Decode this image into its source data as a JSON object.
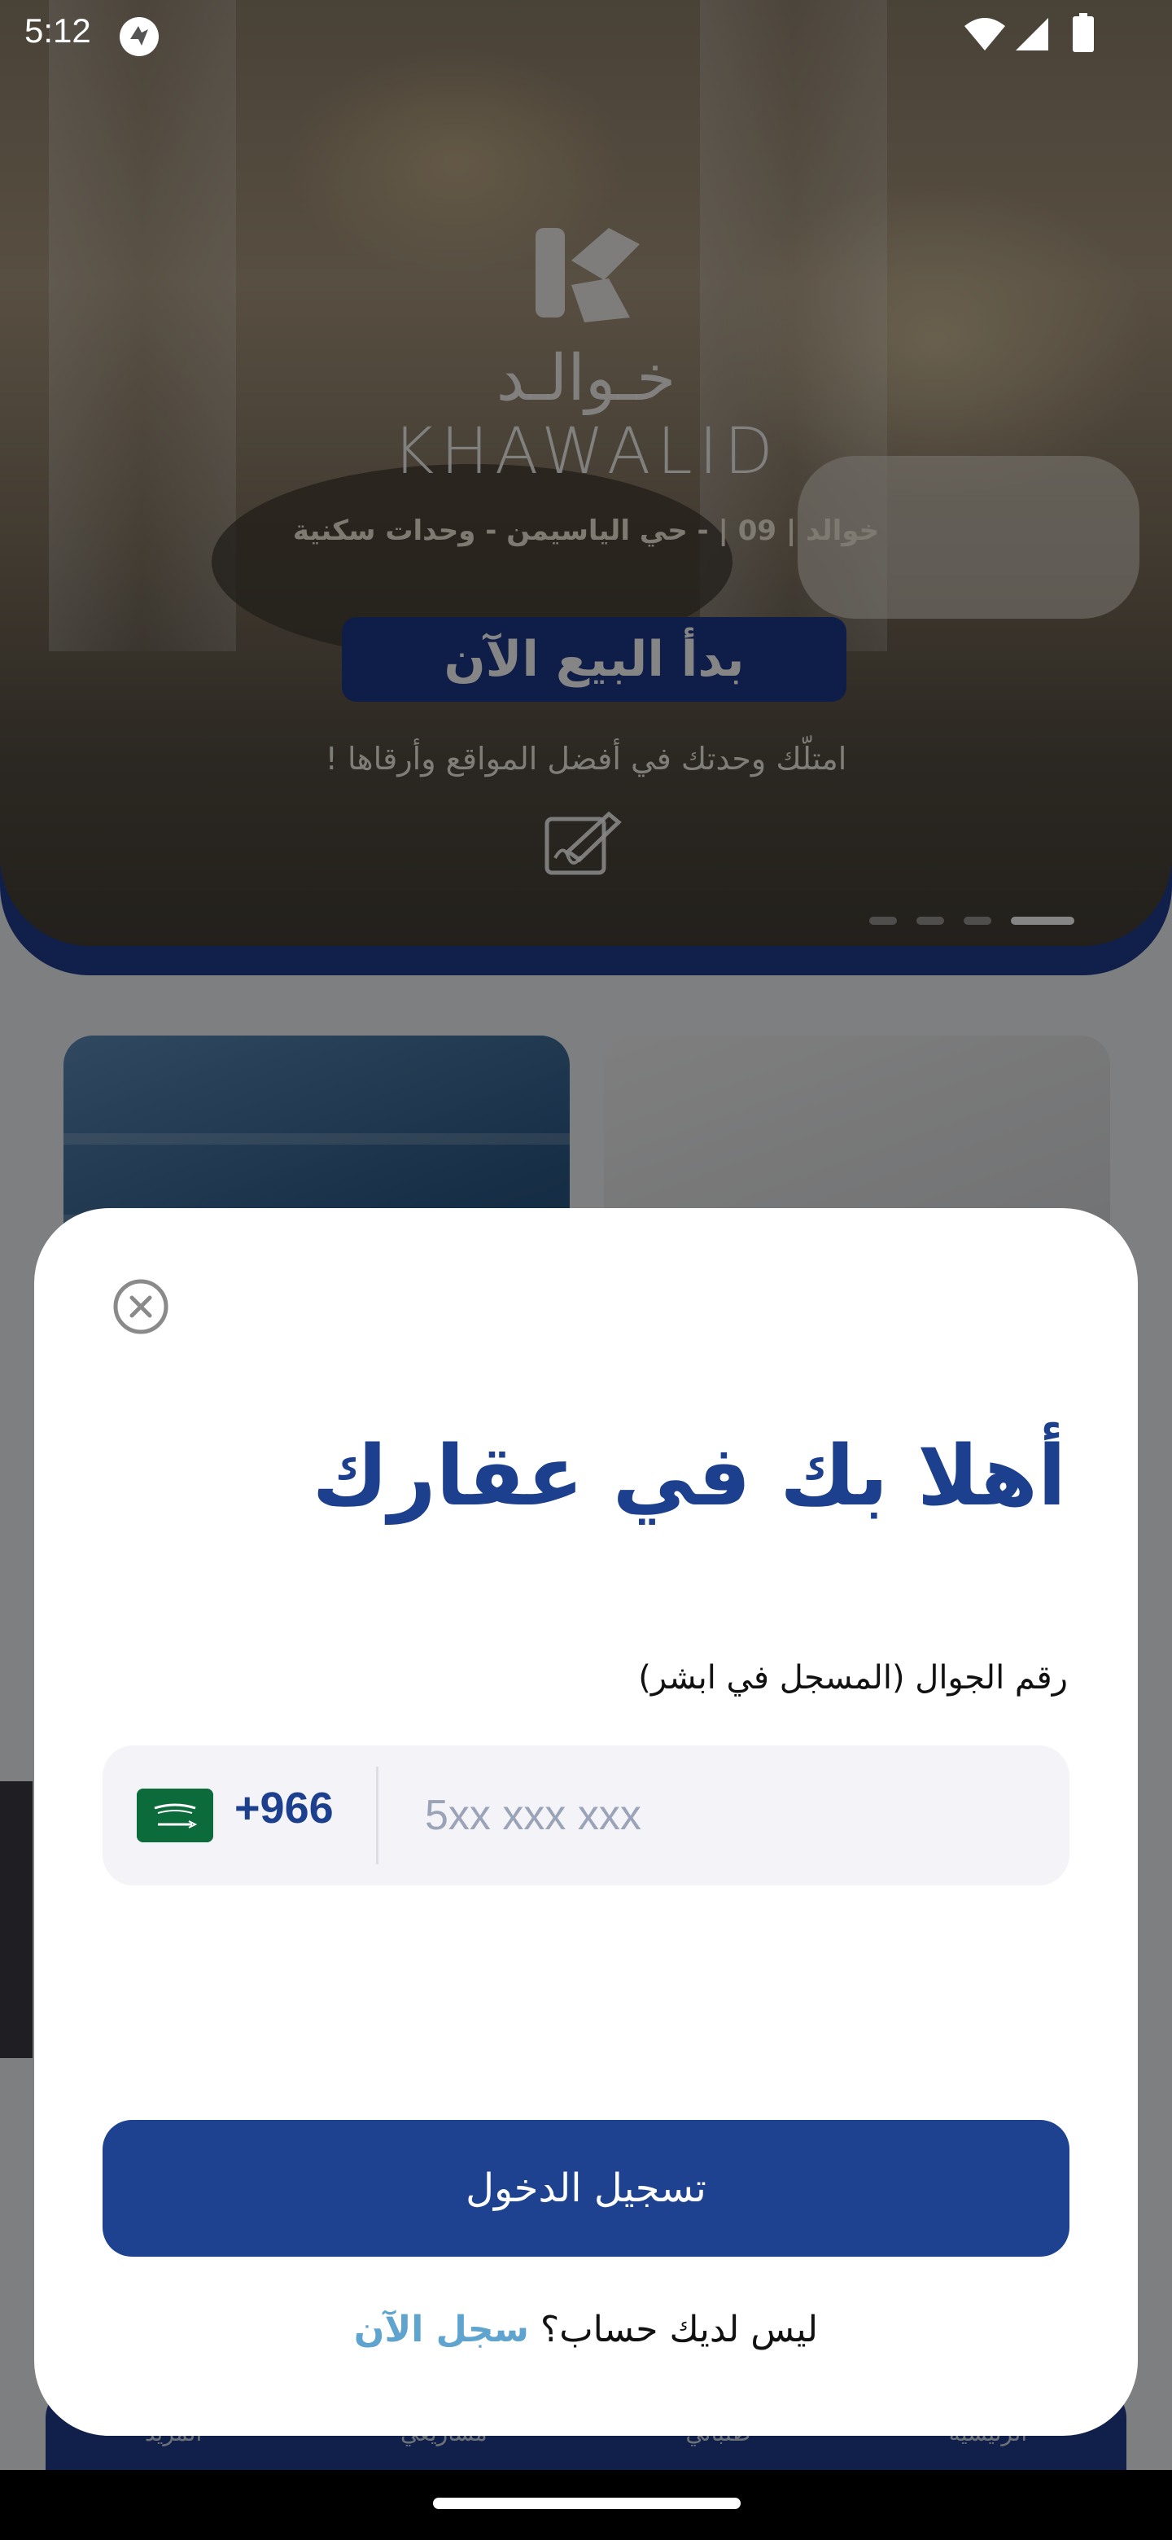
{
  "status_bar": {
    "time": "5:12"
  },
  "hero": {
    "brand_ar": "خـوالـد",
    "brand_en": "KHAWALID",
    "subtitle": "خوالد | 09 | - حي الياسيمن - وحدات سكنية",
    "cta": "بدأ البيع الآن",
    "tagline": "امتلّك وحدتك في أفضل المواقع وأرقاها !"
  },
  "background_nav": {
    "items": [
      "الرئيسية",
      "طلباتي",
      "مشاريعي",
      "المزيد"
    ]
  },
  "login_sheet": {
    "title": "أهلا بك في عقارك",
    "phone_label": "رقم الجوال (المسجل في ابشر)",
    "country_code": "+966",
    "phone_placeholder": "5xx xxx xxx",
    "login_button": "تسجيل الدخول",
    "no_account_text": "ليس لديك حساب؟",
    "signup_link": "سجل الآن"
  },
  "colors": {
    "primary": "#1e4190",
    "link": "#5fa4cf",
    "input_bg": "#f3f3f8"
  }
}
